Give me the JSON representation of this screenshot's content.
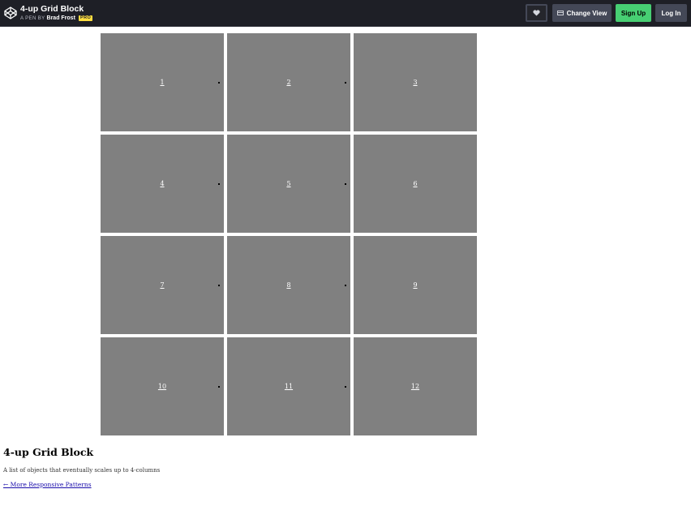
{
  "header": {
    "pen_title": "4-up Grid Block",
    "byline_prefix": "A PEN BY",
    "author": "Brad Frost",
    "badge": "PRO",
    "buttons": {
      "change_view": "Change View",
      "sign_up": "Sign Up",
      "log_in": "Log In"
    },
    "colors": {
      "bar": "#1e1f26",
      "signup": "#47cf73",
      "button": "#444857",
      "pro": "#ffdd40"
    }
  },
  "grid": {
    "items": [
      "1",
      "2",
      "3",
      "4",
      "5",
      "6",
      "7",
      "8",
      "9",
      "10",
      "11",
      "12"
    ],
    "tile_color": "#808080"
  },
  "content": {
    "title": "4-up Grid Block",
    "description": "A list of objects that eventually scales up to 4-columns",
    "back_link": "← More Responsive Patterns"
  }
}
